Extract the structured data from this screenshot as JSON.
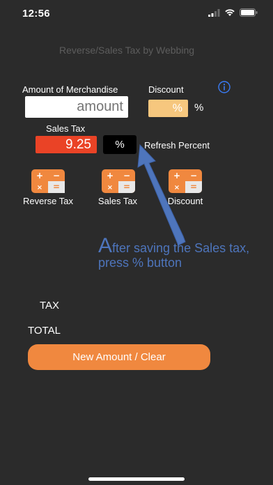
{
  "status_bar": {
    "time": "12:56"
  },
  "app_title": "Reverse/Sales Tax by Webbing",
  "merchandise": {
    "label": "Amount of Merchandise",
    "placeholder": "amount"
  },
  "discount": {
    "label": "Discount",
    "value": "%",
    "unit": "%"
  },
  "sales_tax": {
    "label": "Sales Tax",
    "value": "9.25"
  },
  "percent_button": {
    "label": "%"
  },
  "refresh_label": "Refresh Percent",
  "calculators": [
    {
      "label": "Reverse Tax"
    },
    {
      "label": "Sales Tax"
    },
    {
      "label": "Discount"
    }
  ],
  "hint": {
    "first_letter": "A",
    "rest": "fter saving the Sales tax, press % button"
  },
  "results": {
    "tax_label": "TAX",
    "total_label": "TOTAL"
  },
  "clear_button": {
    "label": "New Amount / Clear"
  },
  "colors": {
    "background": "#2b2b2b",
    "accent_orange": "#f0883f",
    "sales_tax_red": "#ea4326",
    "discount_orange": "#f6c77e",
    "hint_blue": "#4e75bc",
    "info_blue": "#3a7bf5"
  },
  "icons": [
    "cellular-signal-icon",
    "wifi-icon",
    "battery-icon",
    "info-icon",
    "calculator-icon",
    "arrow-icon"
  ]
}
